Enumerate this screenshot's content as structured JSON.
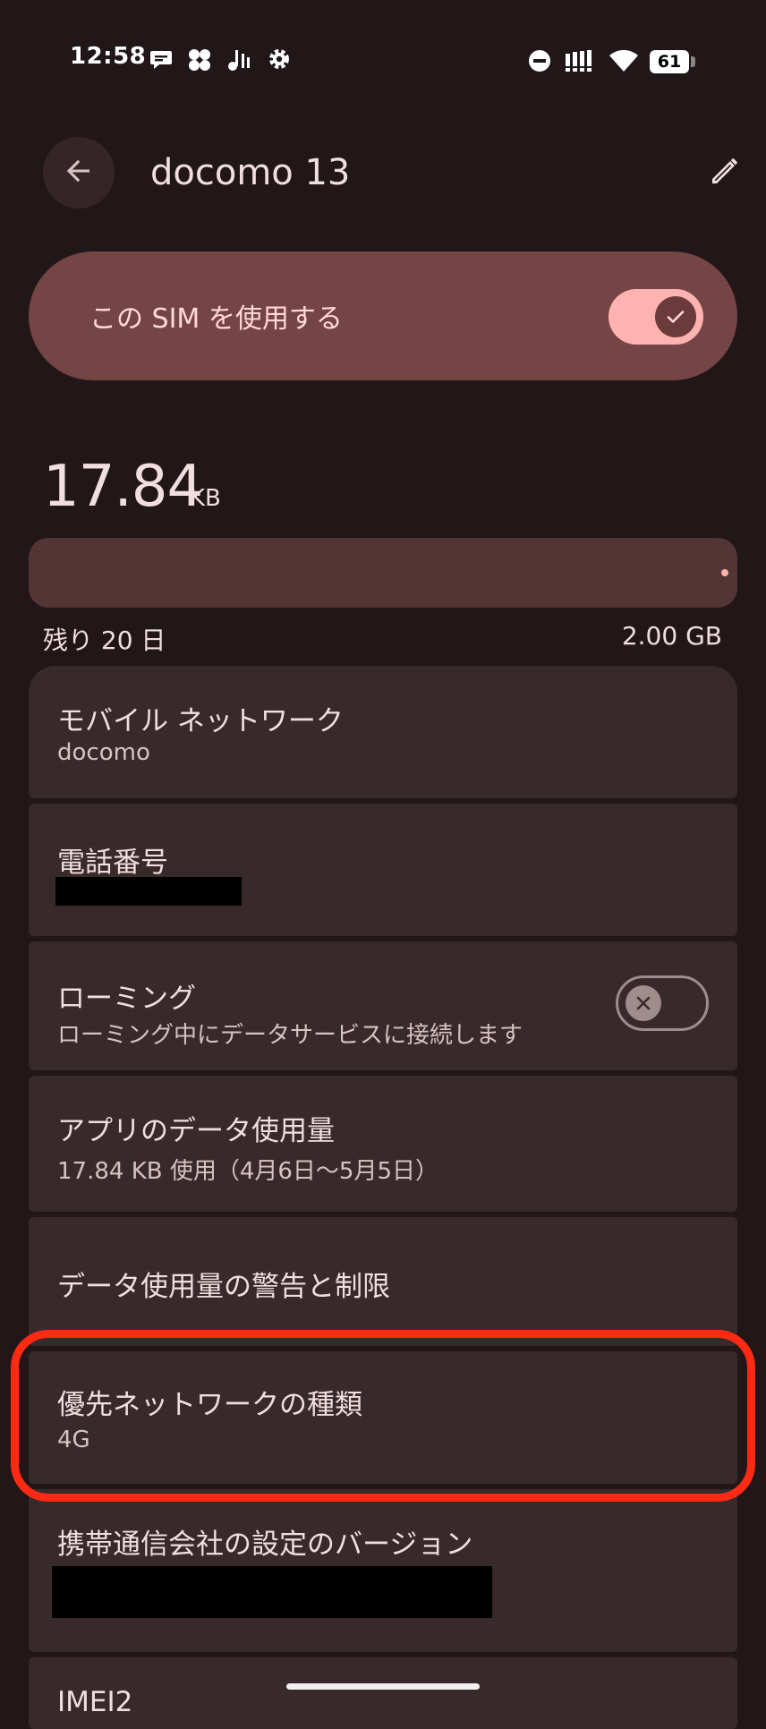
{
  "status_bar": {
    "time": "12:58",
    "battery": "61",
    "icons": [
      "chat-bubble-icon",
      "fan-icon",
      "music-notes-icon",
      "settings-gear-icon",
      "do-not-disturb-icon",
      "signal-icon",
      "wifi-icon",
      "battery-icon"
    ]
  },
  "app_bar": {
    "title": "docomo 13",
    "back_icon": "arrow-back-icon",
    "edit_icon": "pencil-icon"
  },
  "use_sim": {
    "label": "この SIM を使用する",
    "enabled": true
  },
  "usage": {
    "amount": "17.84",
    "unit": "KB",
    "days_left": "残り 20 日",
    "limit": "2.00 GB",
    "fill_fraction": 0.0
  },
  "settings": {
    "mobile_network": {
      "title": "モバイル ネットワーク",
      "summary": "docomo"
    },
    "phone_number": {
      "title": "電話番号"
    },
    "roaming": {
      "title": "ローミング",
      "summary": "ローミング中にデータサービスに接続します",
      "enabled": false
    },
    "app_data_usage": {
      "title": "アプリのデータ使用量",
      "summary": "17.84 KB 使用（4月6日〜5月5日）"
    },
    "data_warning": {
      "title": "データ使用量の警告と制限"
    },
    "preferred_network": {
      "title": "優先ネットワークの種類",
      "summary": "4G"
    },
    "carrier_settings_version": {
      "title": "携帯通信会社の設定のバージョン"
    },
    "imei": {
      "title": "IMEI2"
    }
  },
  "colors": {
    "background": "#211718",
    "card": "#382a2b",
    "accent_card": "#754444",
    "switch_on": "#ffb3b0",
    "highlight": "#ff2a14"
  }
}
